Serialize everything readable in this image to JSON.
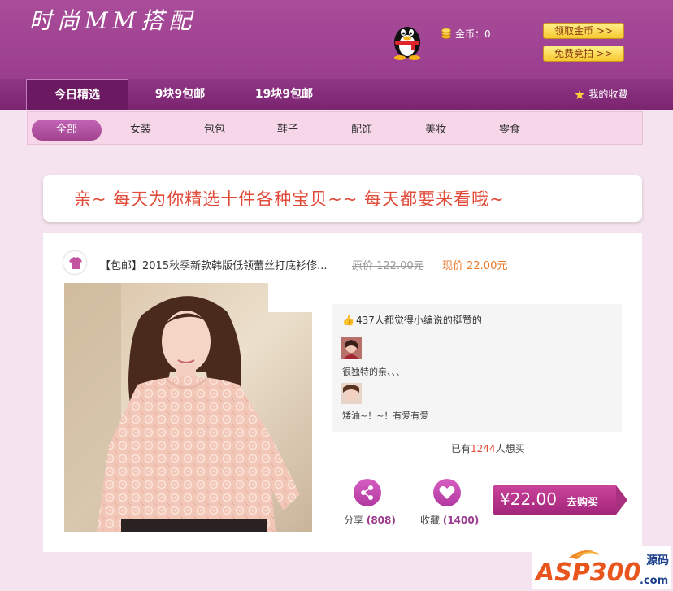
{
  "header": {
    "site_title": "时尚MM搭配",
    "coin_text": "金币：0",
    "claim_coins_button": "领取金币 >>",
    "free_trial_button": "免费竞拍 >>"
  },
  "nav": {
    "tabs": [
      {
        "label": "今日精选"
      },
      {
        "label": "9块9包邮"
      },
      {
        "label": "19块9包邮"
      }
    ],
    "favorites_label": "我的收藏"
  },
  "categories": [
    {
      "label": "全部"
    },
    {
      "label": "女装"
    },
    {
      "label": "包包"
    },
    {
      "label": "鞋子"
    },
    {
      "label": "配饰"
    },
    {
      "label": "美妆"
    },
    {
      "label": "零食"
    }
  ],
  "banner": {
    "text": "亲~ 每天为你精选十件各种宝贝~~ 每天都要来看哦~"
  },
  "product": {
    "title": "【包邮】2015秋季新款韩版低领蕾丝打底衫修...",
    "original_price": "原价 122.00元",
    "current_price": "现价 22.00元",
    "likes_text": "437人都觉得小编说的挺赞的",
    "comments": [
      {
        "text": "很独特的亲、、、"
      },
      {
        "text": "矮油~！~！有爱有爱"
      }
    ],
    "want_prefix": "已有",
    "want_count": "1244",
    "want_suffix": "人想买",
    "share_label": "分享",
    "share_count": "(808)",
    "collect_label": "收藏",
    "collect_count": "(1400)",
    "buy_price": "¥22.00",
    "buy_label": "去购买"
  },
  "watermark": {
    "brand": "ASP300",
    "suffix": "源码",
    "domain": ".com"
  },
  "colors": {
    "header_purple": "#a0449a",
    "nav_purple": "#7b2470",
    "accent_magenta": "#a2257a",
    "banner_red": "#e14b3a",
    "price_orange": "#e8792a"
  }
}
